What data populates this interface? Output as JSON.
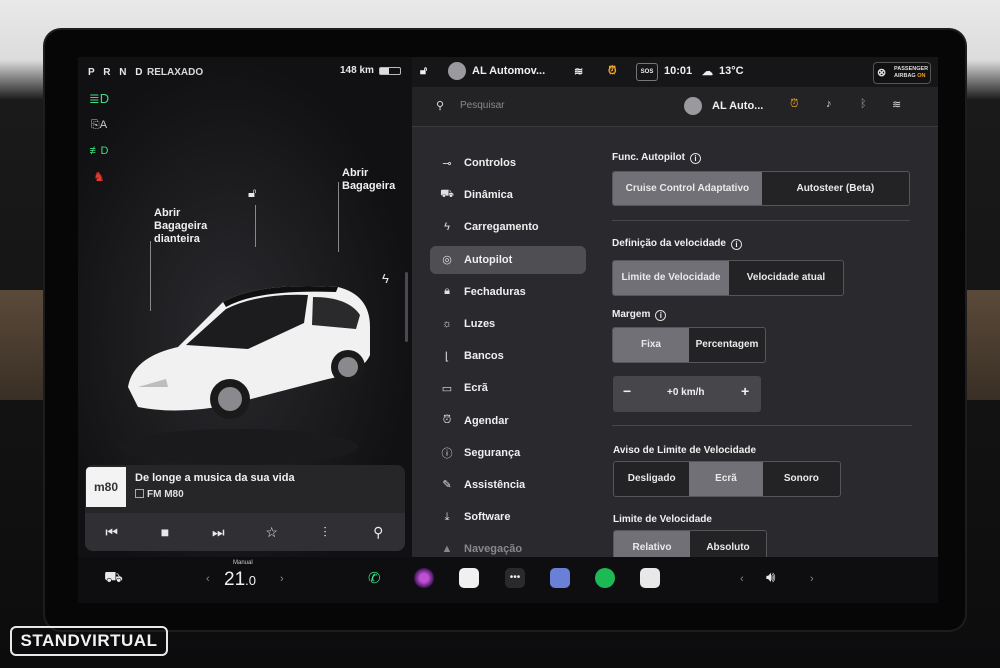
{
  "left": {
    "gear": "P R N D",
    "drive_mode": "RELAXADO",
    "range": "148 km",
    "battery_level": 0.45,
    "labels": {
      "frunk": [
        "Abrir",
        "Bagageira",
        "dianteira"
      ],
      "trunk": [
        "Abrir",
        "Bagageira"
      ]
    },
    "media": {
      "logo": "m80",
      "song": "De longe a musica da sua vida",
      "station": "FM M80"
    }
  },
  "status": {
    "profile": "AL Automov...",
    "time": "10:01",
    "temp": "13°C",
    "sos": "SOS",
    "airbag_line1": "PASSENGER",
    "airbag_line2": "AIRBAG",
    "airbag_state": "ON"
  },
  "search": {
    "placeholder": "Pesquisar",
    "profile": "AL Auto..."
  },
  "menu": [
    {
      "icon": "toggle-icon",
      "glyph": "⊸",
      "label": "Controlos"
    },
    {
      "icon": "car-icon",
      "glyph": "⛟",
      "label": "Dinâmica"
    },
    {
      "icon": "bolt-icon",
      "glyph": "ϟ",
      "label": "Carregamento"
    },
    {
      "icon": "steering-wheel-icon",
      "glyph": "◎",
      "label": "Autopilot"
    },
    {
      "icon": "lock-icon",
      "glyph": "🔒︎",
      "label": "Fechaduras"
    },
    {
      "icon": "sun-icon",
      "glyph": "☼",
      "label": "Luzes"
    },
    {
      "icon": "seat-icon",
      "glyph": "⌊",
      "label": "Bancos"
    },
    {
      "icon": "screen-icon",
      "glyph": "▭",
      "label": "Ecrã"
    },
    {
      "icon": "alarm-icon",
      "glyph": "⏰︎",
      "label": "Agendar"
    },
    {
      "icon": "info-icon",
      "glyph": "ⓘ",
      "label": "Segurança"
    },
    {
      "icon": "wrench-icon",
      "glyph": "✎",
      "label": "Assistência"
    },
    {
      "icon": "download-icon",
      "glyph": "⤓",
      "label": "Software"
    },
    {
      "icon": "navigation-icon",
      "glyph": "▲",
      "label": "Navegação"
    }
  ],
  "content": {
    "autopilot_title": "Func. Autopilot",
    "autopilot_options": [
      "Cruise Control Adaptativo",
      "Autosteer (Beta)"
    ],
    "speed_title": "Definição da velocidade",
    "speed_options": [
      "Limite de Velocidade",
      "Velocidade atual"
    ],
    "margin_title": "Margem",
    "margin_options": [
      "Fixa",
      "Percentagem"
    ],
    "stepper_value": "+0 km/h",
    "warning_title": "Aviso de Limite de Velocidade",
    "warning_options": [
      "Desligado",
      "Ecrã",
      "Sonoro"
    ],
    "limit_title": "Limite de Velocidade",
    "limit_options": [
      "Relativo",
      "Absoluto"
    ]
  },
  "dock": {
    "temp_mode": "Manual",
    "temp": "21",
    "temp_decimal": ".0"
  },
  "watermark": "STANDVIRTUAL",
  "colors": {
    "accent_green": "#3ddc84",
    "indicator_red": "#e03c31",
    "alarm_orange": "#f5a623",
    "spotify": "#1db954"
  }
}
